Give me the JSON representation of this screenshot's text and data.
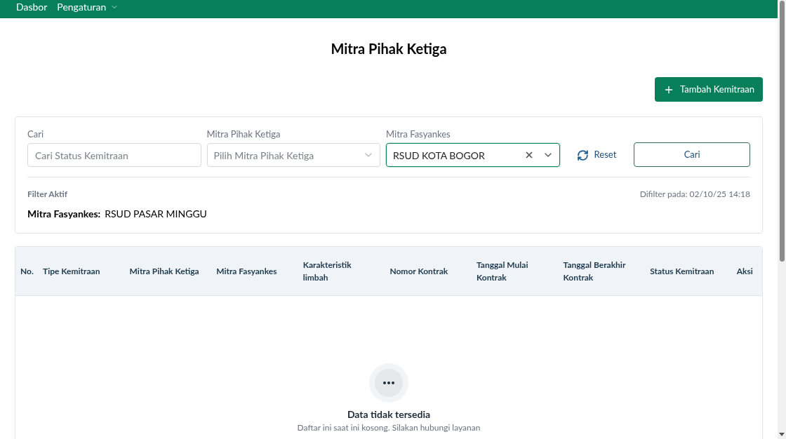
{
  "navbar": {
    "items": [
      {
        "label": "Dasbor",
        "has_dropdown": false
      },
      {
        "label": "Pengaturan",
        "has_dropdown": true
      }
    ]
  },
  "page_title": "Mitra Pihak Ketiga",
  "add_button": {
    "label": "Tambah Kemitraan"
  },
  "filters": {
    "fields": [
      {
        "kind": "text",
        "label": "Cari",
        "placeholder": "Cari Status Kemitraan",
        "focused": false
      },
      {
        "kind": "select",
        "label": "Mitra Pihak Ketiga",
        "placeholder": "Pilih Mitra Pihak Ketiga",
        "focused": false
      },
      {
        "kind": "select",
        "label": "Mitra Fasyankes",
        "value": "RSUD KOTA BOGOR",
        "focused": true
      }
    ],
    "reset_label": "Reset",
    "search_label": "Cari",
    "active_title": "Filter Aktif",
    "filtered_at": "Difilter pada: 02/10/25 14:18",
    "active_filters": [
      {
        "name": "Mitra Fasyankes:",
        "value": "RSUD PASAR MINGGU"
      }
    ]
  },
  "table": {
    "columns": [
      "No.",
      "Tipe Kemitraan",
      "Mitra Pihak Ketiga",
      "Mitra Fasyankes",
      "Karakteristik limbah",
      "Nomor Kontrak",
      "Tanggal Mulai Kontrak",
      "Tanggal Berakhir Kontrak",
      "Status Kemitraan",
      "Aksi"
    ],
    "empty_title": "Data tidak tersedia",
    "empty_text": "Daftar ini saat ini kosong. Silakan hubungi layanan"
  }
}
